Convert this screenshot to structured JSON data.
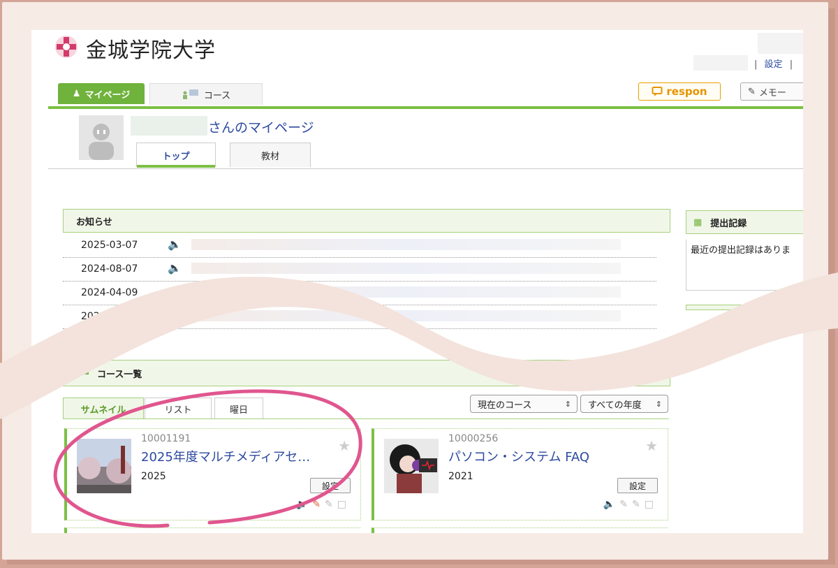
{
  "header": {
    "logo_text": "金城学院大学",
    "settings_link": "設定",
    "separator": "|"
  },
  "nav": {
    "mypage": "マイページ",
    "course": "コース",
    "respon": "respon",
    "memo": "メモー"
  },
  "profile": {
    "title": "さんのマイページ",
    "tabs": [
      "トップ",
      "教材"
    ]
  },
  "news": {
    "heading": "お知らせ",
    "rows": [
      {
        "date": "2025-03-07",
        "icon": "speaker-icon",
        "active": true
      },
      {
        "date": "2024-08-07",
        "icon": "speaker-icon",
        "active": false
      },
      {
        "date": "2024-04-09",
        "icon": "speaker-icon",
        "active": false
      },
      {
        "date": "2024-03-31",
        "icon": "speaker-icon",
        "active": false
      }
    ]
  },
  "submission": {
    "heading": "提出記録",
    "body": "最近の提出記録はありま"
  },
  "courses": {
    "heading": "コース一覧",
    "tabs": [
      "サムネイル",
      "リスト",
      "曜日"
    ],
    "filter_current": "現在のコース",
    "filter_year": "すべての年度",
    "cards": [
      {
        "id": "10001191",
        "title": "2025年度マルチメディアセ…",
        "year": "2025",
        "button": "設定"
      },
      {
        "id": "10000256",
        "title": "パソコン・システム FAQ",
        "year": "2021",
        "button": "設定"
      }
    ]
  },
  "colors": {
    "accent_green": "#7cbf45",
    "link_blue": "#2d4aa0",
    "respon_orange": "#e79400",
    "annotation_pink": "#e0568f"
  }
}
